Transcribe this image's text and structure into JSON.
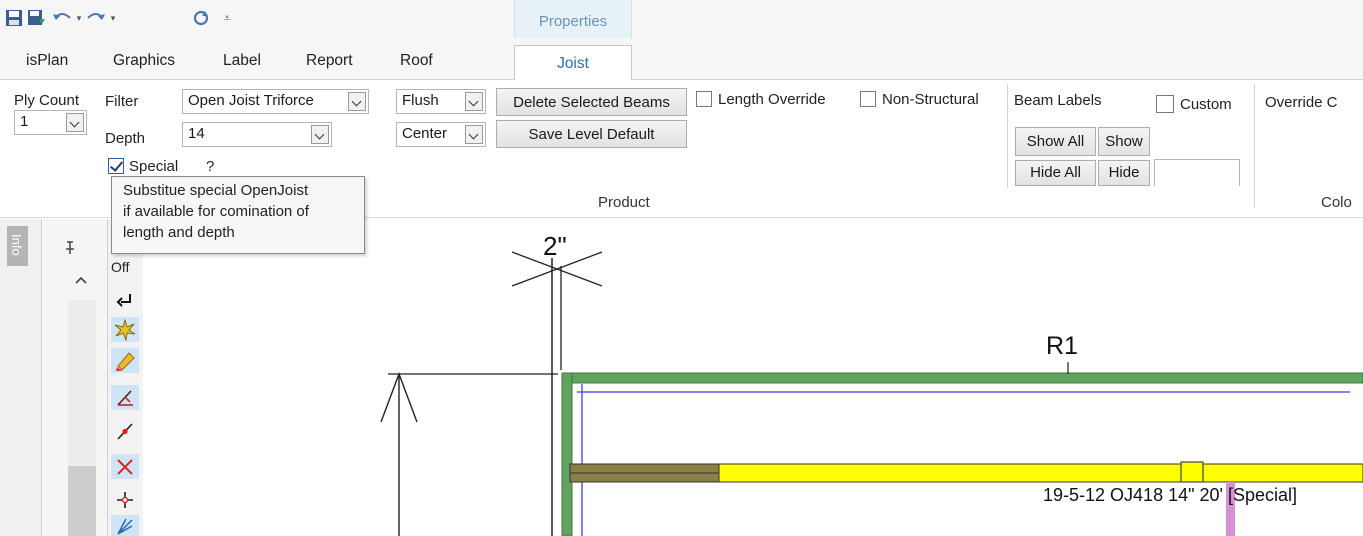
{
  "quick_access": {
    "icons": [
      "save-icon",
      "save-as-icon",
      "undo-icon",
      "dropdown-arrow-icon",
      "redo-icon",
      "dropdown-arrow-icon",
      "refresh-icon",
      "customize-toolbar-icon"
    ]
  },
  "contextual_tab_group": "Properties",
  "tabs": [
    "isPlan",
    "Graphics",
    "Label",
    "Report",
    "Roof",
    "Joist"
  ],
  "active_tab": "Joist",
  "ribbon": {
    "ply_count": {
      "label": "Ply Count",
      "value": "1"
    },
    "filter": {
      "label": "Filter",
      "value": "Open Joist Triforce"
    },
    "depth": {
      "label": "Depth",
      "value": "14"
    },
    "special": {
      "label": "Special",
      "checked": true,
      "help": "?"
    },
    "flush": {
      "value": "Flush"
    },
    "center": {
      "value": "Center"
    },
    "delete_selected_beams": "Delete Selected Beams",
    "save_level_default": "Save Level Default",
    "length_override": {
      "label": "Length Override",
      "checked": false
    },
    "non_structural": {
      "label": "Non-Structural",
      "checked": false
    },
    "beam_labels": {
      "label": "Beam Labels",
      "custom_label": "Custom",
      "custom_checked": false,
      "show_all": "Show All",
      "show": "Show",
      "hide_all": "Hide All",
      "hide": "Hide",
      "custom_value": ""
    },
    "override_label": "Override C",
    "product_group_label": "Product",
    "color_group_label": "Colo"
  },
  "tooltip": {
    "lines": [
      "Substitue special OpenJoist",
      "if available for comination of",
      "length and depth"
    ]
  },
  "side_panel": {
    "info_tab": "Info",
    "pin_icon": "pin-icon",
    "scroll_up_icon": "chevron-up-icon"
  },
  "tools": {
    "off_label": "Off",
    "icons": [
      "return-arrow-icon",
      "explode-icon",
      "pencil-eraser-icon",
      "angle-tool-icon",
      "line-point-icon",
      "delete-x-icon",
      "crosshair-icon",
      "fan-lines-icon"
    ]
  },
  "drawing": {
    "dimension_label": "2\"",
    "room_label": "R1",
    "beam_label": "19-5-12 OJ418 14\" 20' [Special]",
    "colors": {
      "wall_green": "#5fa35f",
      "inner_blue": "#5a5ae0",
      "beam_yellow": "#ffff00",
      "beam_dark": "#8b8048",
      "marker_pink": "#d690d6"
    }
  }
}
